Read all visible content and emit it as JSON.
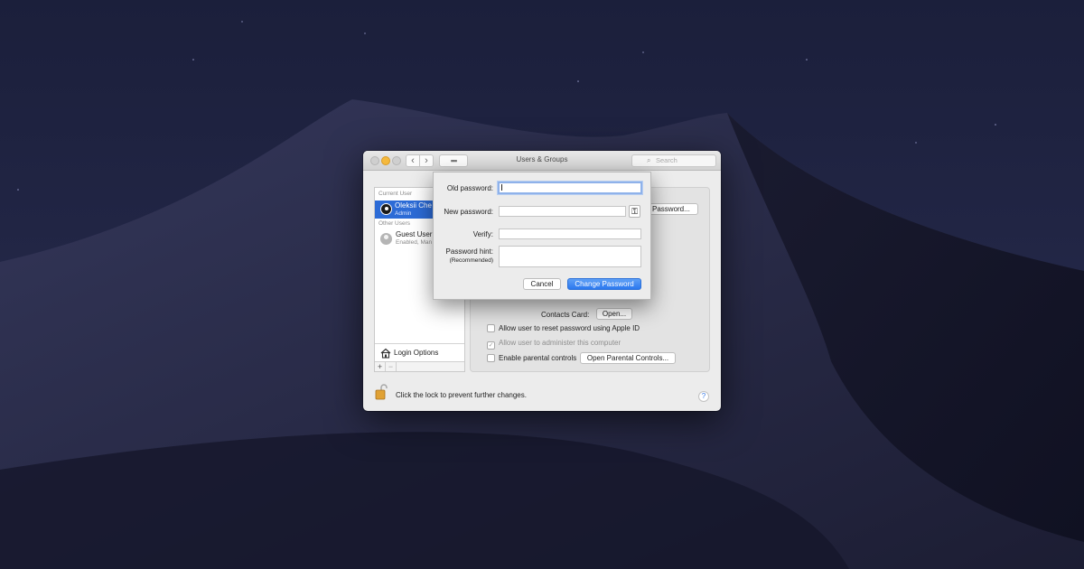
{
  "window": {
    "title": "Users & Groups",
    "search_placeholder": "Search"
  },
  "sidebar": {
    "current_user_header": "Current User",
    "current_user": {
      "name": "Oleksii Che",
      "role": "Admin"
    },
    "other_users_header": "Other Users",
    "other_user": {
      "name": "Guest User",
      "status": "Enabled, Man"
    },
    "login_options_label": "Login Options",
    "add_label": "+",
    "remove_label": "−"
  },
  "content": {
    "change_password_button": "Password...",
    "contacts_card_label": "Contacts Card:",
    "contacts_open_button": "Open...",
    "checkboxes": [
      {
        "label": "Allow user to reset password using Apple ID",
        "checked": false,
        "enabled": true
      },
      {
        "label": "Allow user to administer this computer",
        "checked": true,
        "enabled": false
      },
      {
        "label": "Enable parental controls",
        "checked": false,
        "enabled": true
      }
    ],
    "parental_controls_button": "Open Parental Controls..."
  },
  "footer": {
    "lock_text": "Click the lock to prevent further changes.",
    "help_label": "?"
  },
  "dialog": {
    "old_password_label": "Old password:",
    "new_password_label": "New password:",
    "verify_label": "Verify:",
    "hint_label": "Password hint:",
    "hint_sublabel": "(Recommended)",
    "old_password_value": "",
    "new_password_value": "",
    "verify_value": "",
    "hint_value": "",
    "cancel_button": "Cancel",
    "change_button": "Change Password"
  },
  "colors": {
    "desktop_sky": "#1f2340",
    "dune": "#2a2d4e",
    "selection_blue": "#2c6bd6",
    "primary_button": "#2b78ef"
  }
}
